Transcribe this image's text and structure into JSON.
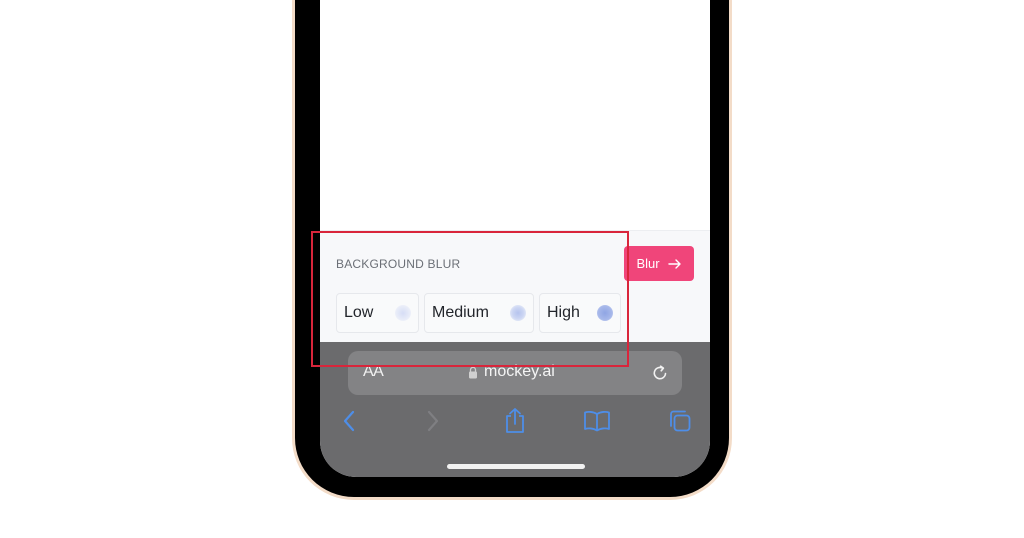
{
  "panel": {
    "title": "BACKGROUND BLUR",
    "blur_button_label": "Blur",
    "options": [
      {
        "label": "Low"
      },
      {
        "label": "Medium"
      },
      {
        "label": "High"
      }
    ]
  },
  "safari": {
    "text_size_label": "AA",
    "url": "mockey.ai",
    "toolbar_icons": [
      "back-icon",
      "forward-icon",
      "share-icon",
      "bookmarks-icon",
      "tabs-icon"
    ]
  },
  "colors": {
    "accent_pink": "#f0457a",
    "highlight_red": "#d9253b",
    "safari_blue": "#4e8ee8",
    "chrome_gray": "#6b6b6d"
  }
}
